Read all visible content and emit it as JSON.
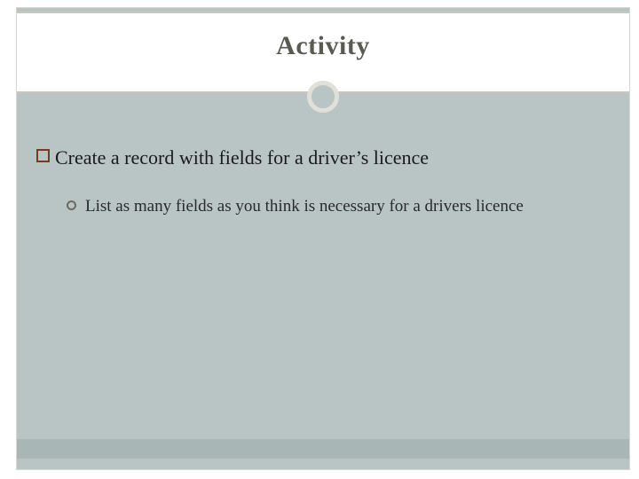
{
  "slide": {
    "title": "Activity",
    "bullets": [
      {
        "text": "Create a record with fields for a driver’s licence",
        "sub": [
          {
            "text": "List as many fields as you think is necessary for a drivers licence"
          }
        ]
      }
    ]
  }
}
